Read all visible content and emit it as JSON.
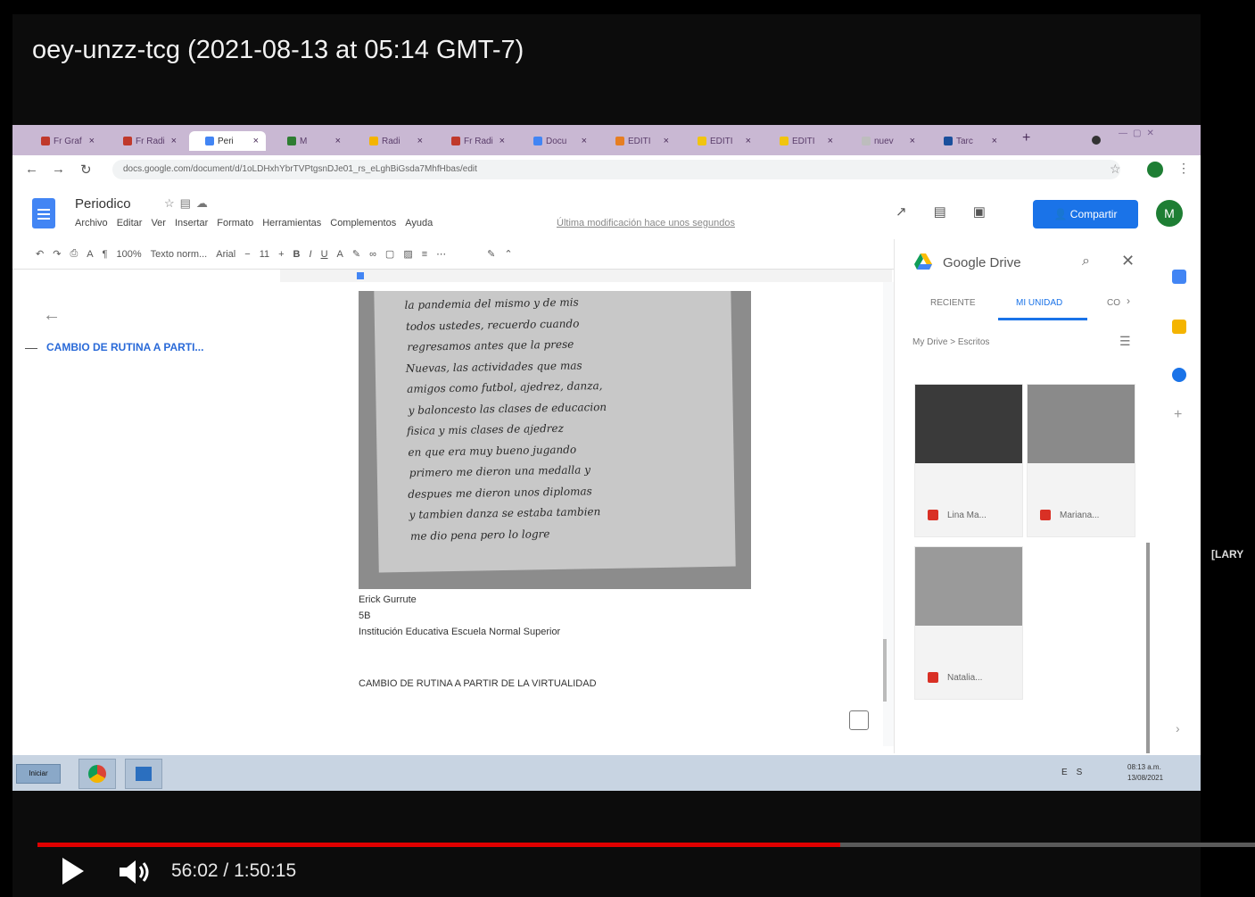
{
  "video": {
    "title": "oey-unzz-tcg (2021-08-13 at 05:14 GMT-7)",
    "side_label": "[LARY",
    "time_current": "56:02",
    "time_separator": " / ",
    "time_total": "1:50:15",
    "progress_fraction": 0.659
  },
  "browser": {
    "tabs": [
      {
        "label": "Fr Graf",
        "color": "#c0392b"
      },
      {
        "label": "Fr Radi",
        "color": "#c0392b"
      },
      {
        "label": "Peri",
        "color": "#4285f4",
        "active": true
      },
      {
        "label": "M",
        "color": "#2e7d32"
      },
      {
        "label": "Radi",
        "color": "#f4b400"
      },
      {
        "label": "Fr Radi",
        "color": "#c0392b"
      },
      {
        "label": "Docu",
        "color": "#4285f4"
      },
      {
        "label": "EDITI",
        "color": "#e67e22"
      },
      {
        "label": "EDITI",
        "color": "#f1c40f"
      },
      {
        "label": "EDITI",
        "color": "#f1c40f"
      },
      {
        "label": "nuev",
        "color": "#bdbdbd"
      },
      {
        "label": "Tarc",
        "color": "#1a4f9c"
      }
    ],
    "new_tab": "+",
    "url": "docs.google.com/document/d/1oLDHxhYbrTVPtgsnDJe01_rs_eLghBiGsda7MhfHbas/edit"
  },
  "docs": {
    "title": "Periodico",
    "menus": [
      "Archivo",
      "Editar",
      "Ver",
      "Insertar",
      "Formato",
      "Herramientas",
      "Complementos",
      "Ayuda"
    ],
    "last_edit": "Última modificación hace unos segundos",
    "share_label": "Compartir",
    "avatar_letter": "M",
    "toolbar": {
      "zoom": "100%",
      "style": "Texto norm...",
      "font": "Arial",
      "size": "11"
    },
    "outline_item": "CAMBIO DE RUTINA A PARTI...",
    "handwriting": [
      "la pandemia del mismo y de mis",
      "todos ustedes, recuerdo cuando",
      "regresamos antes que la prese",
      "Nuevas, las actividades que mas",
      "amigos como futbol, ajedrez, danza,",
      "y baloncesto las clases de educacion",
      "fisica y mis clases de ajedrez",
      "en que era muy bueno jugando",
      "primero me dieron una medalla y",
      "despues me dieron unos diplomas",
      "y tambien danza se estaba tambien",
      "me dio pena pero lo logre"
    ],
    "caption": {
      "author": "Erick Gurrute",
      "grade": "5B",
      "school": "Institución Educativa Escuela Normal Superior"
    },
    "heading": "CAMBIO DE RUTINA A PARTIR DE LA VIRTUALIDAD"
  },
  "drive": {
    "title": "Google Drive",
    "tabs": [
      "RECIENTE",
      "MI UNIDAD",
      "CO"
    ],
    "breadcrumb": "My Drive  >  Escritos",
    "files": [
      {
        "label": "Lina Ma...",
        "color": "#3a3a3a"
      },
      {
        "label": "Mariana...",
        "color": "#8a8a8a"
      },
      {
        "label": "Natalia...",
        "color": "#9a9a9a"
      }
    ]
  },
  "taskbar": {
    "start_label": "Iniciar",
    "tray": "ES",
    "clock_time": "08:13 a.m.",
    "clock_date": "13/08/2021"
  }
}
